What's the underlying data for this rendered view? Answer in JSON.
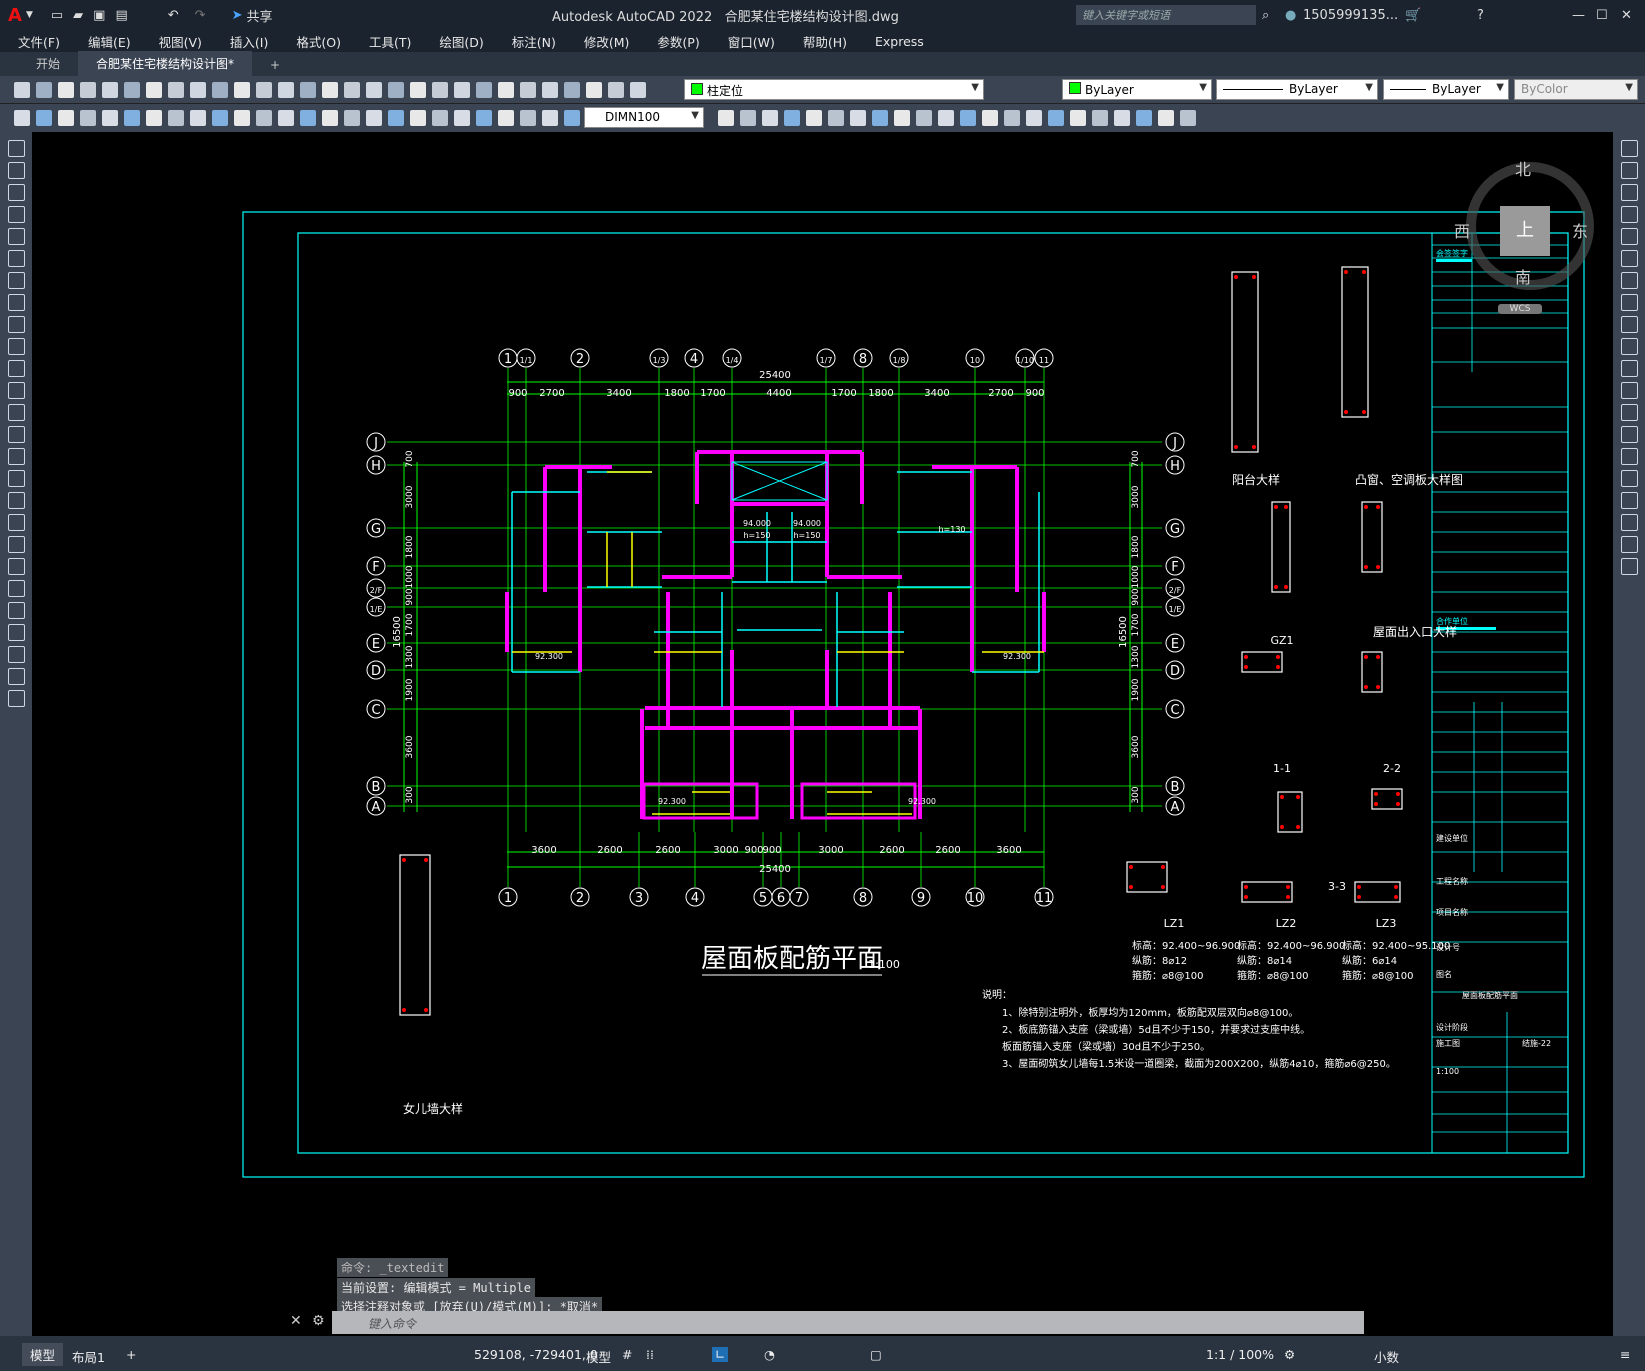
{
  "app": {
    "title": "Autodesk AutoCAD 2022",
    "filename": "合肥某住宅楼结构设计图.dwg",
    "share_label": "共享",
    "search_placeholder": "键入关键字或短语",
    "user": "1505999135...",
    "win_controls": [
      "—",
      "☐",
      "✕"
    ]
  },
  "menu": [
    "文件(F)",
    "编辑(E)",
    "视图(V)",
    "插入(I)",
    "格式(O)",
    "工具(T)",
    "绘图(D)",
    "标注(N)",
    "修改(M)",
    "参数(P)",
    "窗口(W)",
    "帮助(H)",
    "Express"
  ],
  "tabs": [
    "开始",
    "合肥某住宅楼结构设计图*",
    "+"
  ],
  "toolbar": {
    "layer_value": "柱定位",
    "color_value": "ByLayer",
    "linetype_value": "ByLayer",
    "lineweight_value": "ByLayer",
    "plotstyle_value": "ByColor",
    "dimstyle_value": "DIMN100"
  },
  "viewcube": {
    "north": "北",
    "south": "南",
    "east": "东",
    "west": "西",
    "top": "上",
    "wcs": "WCS"
  },
  "drawing": {
    "main_title": "屋面板配筋平面",
    "scale": "1:100",
    "overall_dim": "25400",
    "top_axes": [
      "1",
      "1/1",
      "2",
      "1/3",
      "4",
      "1/4",
      "1/7",
      "8",
      "1/8",
      "10",
      "1/10",
      "11"
    ],
    "top_dims": [
      "900",
      "2700",
      "3400",
      "1800",
      "1700",
      "4400",
      "1700",
      "1800",
      "3400",
      "2700",
      "900"
    ],
    "bottom_axes": [
      "1",
      "2",
      "3",
      "4",
      "5",
      "6",
      "7",
      "8",
      "9",
      "10",
      "11"
    ],
    "bottom_dims": [
      "3600",
      "2600",
      "2600",
      "3000",
      "900",
      "900",
      "3000",
      "2600",
      "2600",
      "3600"
    ],
    "row_axes": [
      "J",
      "H",
      "G",
      "F",
      "2/F",
      "1/E",
      "E",
      "D",
      "C",
      "B",
      "A"
    ],
    "row_dims": [
      "700",
      "3000",
      "1800",
      "1000",
      "900",
      "1700",
      "1300",
      "1900",
      "3600",
      "300"
    ],
    "side_total": "16500",
    "labels": {
      "balcony": "阳台大样",
      "window": "凸窗、空调板大样图",
      "entrance": "屋面出入口大样",
      "parapet": "女儿墙大样",
      "gz1": "GZ1",
      "sec11": "1-1",
      "sec22": "2-2",
      "sec33": "3-3",
      "lz1": "LZ1",
      "lz2": "LZ2",
      "lz3": "LZ3"
    },
    "column_specs": [
      {
        "elev": "标高：92.400~96.900",
        "long": "纵筋：8⌀12",
        "stir": "箍筋：⌀8@100"
      },
      {
        "elev": "标高：92.400~96.900",
        "long": "纵筋：8⌀14",
        "stir": "箍筋：⌀8@100"
      },
      {
        "elev": "标高：92.400~95.100",
        "long": "纵筋：6⌀14",
        "stir": "箍筋：⌀8@100"
      }
    ],
    "notes_title": "说明：",
    "notes": [
      "1、除特别注明外，板厚均为120mm，板筋配双层双向⌀8@100。",
      "2、板底筋锚入支座（梁或墙）5d且不少于150，并要求过支座中线。",
      "   板面筋锚入支座（梁或墙）30d且不少于250。",
      "3、屋面砌筑女儿墙每1.5米设一道圈梁，截面为200X200，纵筋4⌀10，箍筋⌀6@250。"
    ],
    "slab_labels": [
      "92.300",
      "92.300",
      "92.300",
      "92.300",
      "94.000",
      "94.000",
      "h=150",
      "h=150",
      "h=130"
    ],
    "title_block": [
      "会签签字",
      "合作单位",
      "建设单位",
      "工程名称",
      "项目名称",
      "设计号",
      "图名",
      "屋面板配筋平面",
      "设计阶段",
      "施工图",
      "结施-22",
      "1:100"
    ]
  },
  "command": {
    "history": [
      "命令: _textedit",
      "当前设置: 编辑模式 = Multiple",
      "选择注释对象或 [放弃(U)/模式(M)]: *取消*"
    ],
    "placeholder": "键入命令"
  },
  "status": {
    "model_tab": "模型",
    "layout_tab": "布局1",
    "coords": "529108, -729401, 0",
    "model": "模型",
    "scale": "1:1 / 100%",
    "units": "小数"
  },
  "colors": {
    "green": "#00ff00",
    "magenta": "#ff00ff",
    "cyan": "#00ffff",
    "yellow": "#ffff00",
    "red": "#ff0000",
    "bg": "#000000"
  }
}
